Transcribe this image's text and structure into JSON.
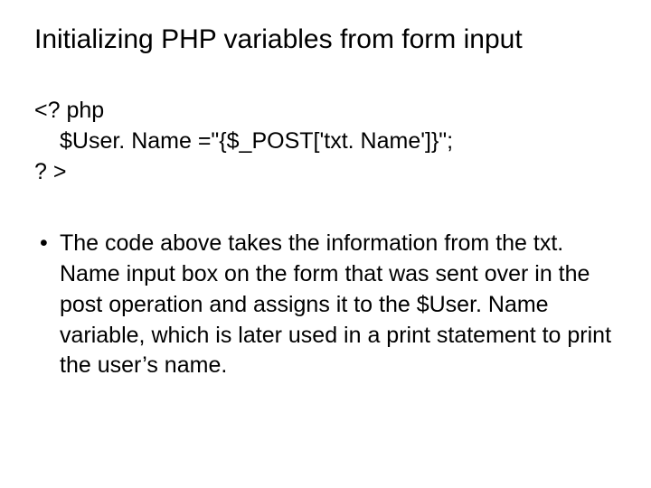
{
  "slide": {
    "title": "Initializing PHP variables from form input",
    "code": {
      "line1": "<? php",
      "line2": "$User. Name =\"{$_POST['txt. Name']}\";",
      "line3": "? >"
    },
    "bullet": {
      "marker": "•",
      "text": "The code above takes the information from the txt. Name input box on the form that was sent over in the post operation and assigns it to the $User. Name variable, which is later used in a print statement to print the user’s name."
    }
  }
}
